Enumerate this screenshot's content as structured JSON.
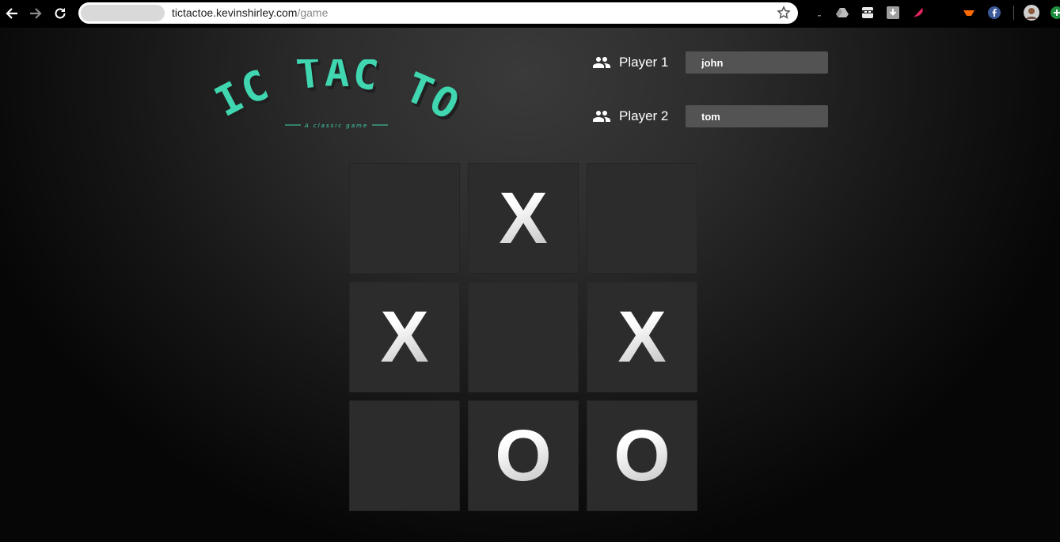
{
  "browser": {
    "url_host": "tictactoe.kevinshirley.com",
    "url_path": "/game",
    "icons": [
      "back-arrow-icon",
      "forward-arrow-icon",
      "reload-icon",
      "star-icon"
    ],
    "extensions": [
      "google-drive-icon",
      "ninja-extension-icon",
      "download-icon",
      "feather-icon",
      "orange-extension-icon",
      "facebook-icon",
      "profile-avatar-icon",
      "green-extension-icon"
    ]
  },
  "logo": {
    "title": "TIC TAC TOE",
    "tagline": "A classic game",
    "color": "#3fd6b0"
  },
  "players": [
    {
      "label": "Player 1",
      "name": "john",
      "icon": "people-icon"
    },
    {
      "label": "Player 2",
      "name": "tom",
      "icon": "people-icon"
    }
  ],
  "board": {
    "cells": [
      "",
      "X",
      "",
      "X",
      "",
      "X",
      "",
      "O",
      "O"
    ]
  }
}
